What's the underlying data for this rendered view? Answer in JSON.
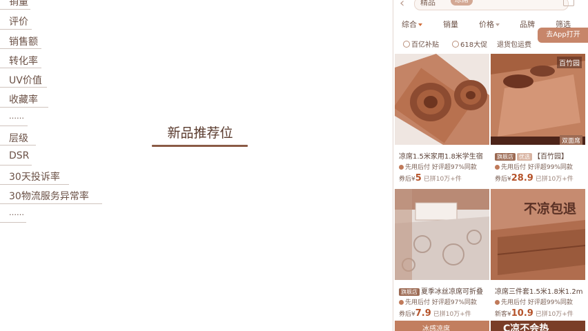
{
  "metrics": {
    "items": [
      "销量",
      "评价",
      "销售额",
      "转化率",
      "UV价值",
      "收藏率",
      "……",
      "层级",
      "DSR",
      "30天投诉率",
      "30物流服务异常率",
      "……"
    ]
  },
  "center": {
    "title": "新品推荐位"
  },
  "phone": {
    "search": {
      "category": "精品",
      "tag": "凉席"
    },
    "sort": {
      "items": [
        "综合",
        "销量",
        "价格",
        "品牌",
        "筛选"
      ]
    },
    "app_button": "去App打开",
    "filters": [
      "百亿补贴",
      "618大促",
      "退货包运费"
    ],
    "products": [
      {
        "title": "凉席1.5米家用1.8米学生宿",
        "badges": [],
        "pay": "先用后付",
        "rating": "好评超97%同款",
        "price_prefix": "券后¥",
        "price": "5",
        "sold": "已拼10万+件",
        "overlay": ""
      },
      {
        "title": "【百竹园】",
        "badges": [
          "旗舰店",
          "优选"
        ],
        "pay": "先用后付",
        "rating": "好评超99%同款",
        "price_prefix": "券后¥",
        "price": "28.9",
        "sold": "已拼10万+件",
        "overlay": "百竹园",
        "overlay2": "双面席"
      },
      {
        "title": "夏季冰丝凉席可折叠",
        "badges": [
          "旗舰店"
        ],
        "pay": "先用后付",
        "rating": "好评超97%同款",
        "price_prefix": "券后¥",
        "price": "7.9",
        "sold": "已拼10万+件",
        "overlay": ""
      },
      {
        "title": "凉席三件套1.5米1.8米1.2m",
        "badges": [],
        "pay": "先用后付",
        "rating": "好评超99%同款",
        "price_prefix": "新客¥",
        "price": "10.9",
        "sold": "已拼10万+件",
        "overlay": "不凉包退"
      }
    ],
    "bottom_left": "冰感凉席",
    "bottom_right": "C凉不会热"
  },
  "colors": {
    "accent": "#c7866a",
    "price": "#b5532a",
    "text": "#6b5146"
  }
}
